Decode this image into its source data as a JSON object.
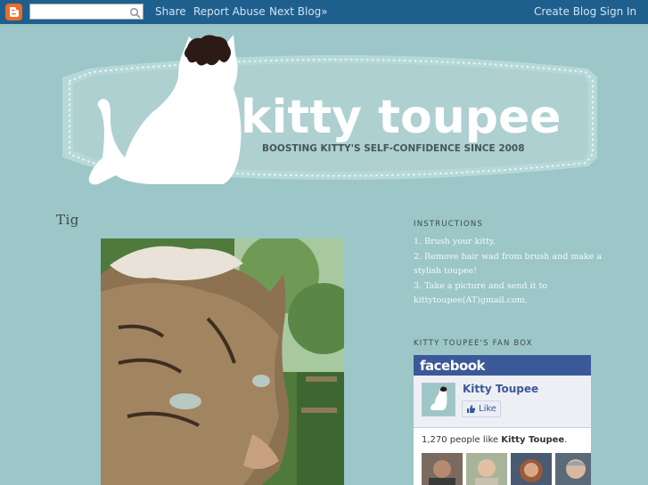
{
  "navbar": {
    "share": "Share",
    "report_abuse": "Report Abuse",
    "next_blog": "Next Blog»",
    "create_blog": "Create Blog",
    "sign_in": "Sign In"
  },
  "header": {
    "title": "kitty toupee",
    "tagline": "BOOSTING KITTY'S SELF-CONFIDENCE SINCE 2008"
  },
  "post": {
    "title": "Tig"
  },
  "sidebar": {
    "instructions_heading": "INSTRUCTIONS",
    "instructions": [
      "1. Brush your kitty.",
      "2. Remove hair wad from brush and make a",
      "stylish toupee!",
      "3. Take a picture and send it to",
      "kittytoupee(AT)gmail.com."
    ],
    "fanbox_heading": "KITTY TOUPEE'S FAN BOX"
  },
  "facebook": {
    "logo": "facebook",
    "page_name": "Kitty Toupee",
    "like_label": "Like",
    "count_text": "1,270 people like ",
    "count_name": "Kitty Toupee",
    "count_end": "."
  },
  "colors": {
    "navbar": "#1f5f8e",
    "background": "#9cc6c7",
    "facebook": "#3b5998"
  }
}
